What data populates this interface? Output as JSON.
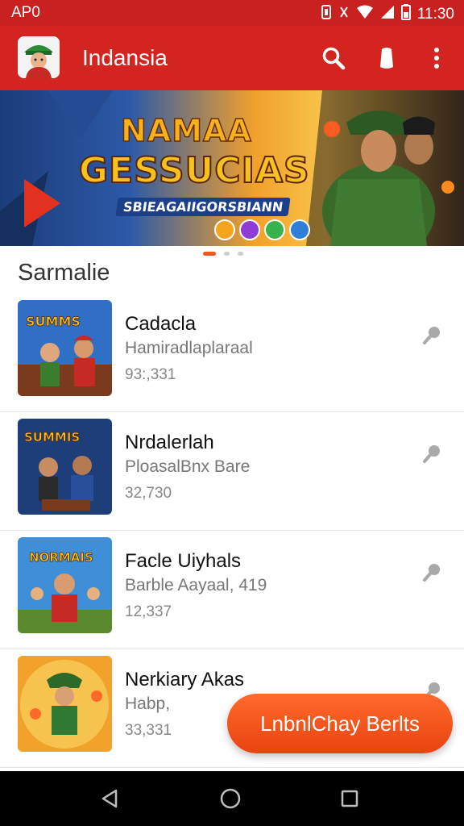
{
  "status_bar": {
    "carrier": "AP0",
    "time": "11:30"
  },
  "app_bar": {
    "title": "Indansia"
  },
  "banner": {
    "title_line1": "NAMAA",
    "title_line2": "GESSUCIAS",
    "subtitle": "SBIEAGAIIGORSBIANN",
    "colors": [
      "#f5a51b",
      "#8f3bd6",
      "#37b24d",
      "#2f7fd8"
    ]
  },
  "pager": {
    "count": 3,
    "active": 0
  },
  "section": {
    "title": "Sarmalie"
  },
  "games": [
    {
      "name": "Cadacla",
      "subtitle": "Hamiradlaplaraal",
      "count": "93:,331"
    },
    {
      "name": "Nrdalerlah",
      "subtitle": "PloasalBnx Bare",
      "count": "32,730"
    },
    {
      "name": "Facle Uiyhals",
      "subtitle": "Barble Aayaal, 419",
      "count": "12,337"
    },
    {
      "name": "Nerkiary Akas",
      "subtitle": "Habp,",
      "count": "33,331"
    }
  ],
  "fab": {
    "label": "LnbnlChay Berlts"
  },
  "theme": {
    "primary": "#d32420",
    "accent": "#ef5a1d"
  }
}
